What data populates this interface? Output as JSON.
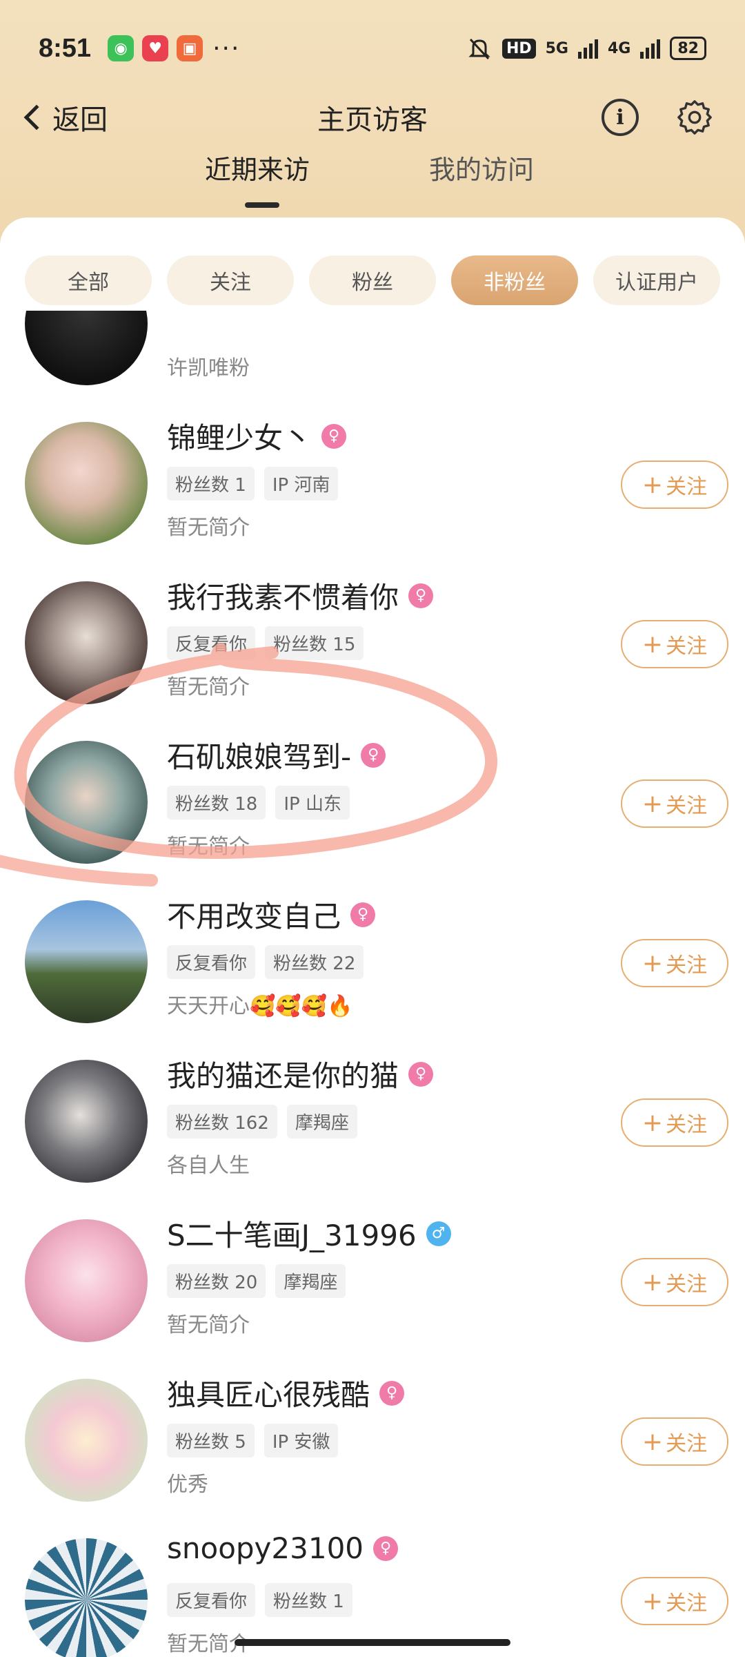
{
  "status_bar": {
    "time": "8:51",
    "more": "···",
    "hd": "HD",
    "net1": "5G",
    "net2": "4G",
    "battery": "82"
  },
  "header": {
    "back_label": "返回",
    "title": "主页访客"
  },
  "tabs": [
    {
      "label": "近期来访",
      "active": true
    },
    {
      "label": "我的访问",
      "active": false
    }
  ],
  "filters": [
    {
      "label": "全部",
      "active": false
    },
    {
      "label": "关注",
      "active": false
    },
    {
      "label": "粉丝",
      "active": false
    },
    {
      "label": "非粉丝",
      "active": true
    },
    {
      "label": "认证用户",
      "active": false
    }
  ],
  "follow_label": "关注",
  "colors": {
    "accent": "#e39a52",
    "chip_active": "#dca674",
    "female": "#f07aa8",
    "male": "#4fb3f0",
    "annotation": "#f5a08f"
  },
  "visitors": [
    {
      "name": "",
      "gender": "",
      "tags": [],
      "bio": "许凯唯粉"
    },
    {
      "name": "锦鲤少女丶",
      "gender": "female",
      "tags": [
        "粉丝数 1",
        "IP 河南"
      ],
      "bio": "暂无简介"
    },
    {
      "name": "我行我素不惯着你",
      "gender": "female",
      "tags": [
        "反复看你",
        "粉丝数 15"
      ],
      "bio": "暂无简介"
    },
    {
      "name": "石矶娘娘驾到-",
      "gender": "female",
      "tags": [
        "粉丝数 18",
        "IP 山东"
      ],
      "bio": "暂无简介"
    },
    {
      "name": "不用改变自己",
      "gender": "female",
      "tags": [
        "反复看你",
        "粉丝数 22"
      ],
      "bio": "天天开心🥰🥰🥰🔥"
    },
    {
      "name": "我的猫还是你的猫",
      "gender": "female",
      "tags": [
        "粉丝数 162",
        "摩羯座"
      ],
      "bio": "各自人生"
    },
    {
      "name": "S二十笔画J_31996",
      "gender": "male",
      "tags": [
        "粉丝数 20",
        "摩羯座"
      ],
      "bio": "暂无简介"
    },
    {
      "name": "独具匠心很残酷",
      "gender": "female",
      "tags": [
        "粉丝数 5",
        "IP 安徽"
      ],
      "bio": "优秀"
    },
    {
      "name": "snoopy23100",
      "gender": "female",
      "tags": [
        "反复看你",
        "粉丝数 1"
      ],
      "bio": "暂无简介"
    }
  ]
}
